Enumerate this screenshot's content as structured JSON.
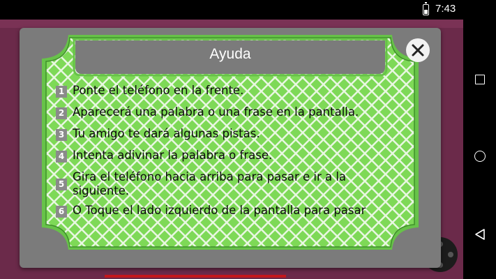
{
  "status_bar": {
    "time": "7:43",
    "battery_icon": "battery-charging-icon"
  },
  "nav_bar": {
    "recents_icon": "square-icon",
    "home_icon": "circle-icon",
    "back_icon": "triangle-back-icon"
  },
  "dialog": {
    "title": "Ayuda",
    "close_icon": "close-icon",
    "pattern_color": "#7ed957",
    "frame_color": "#67c249",
    "steps": [
      {
        "number": "1",
        "text": "Ponte el teléfono en la frente."
      },
      {
        "number": "2",
        "text": "Aparecerá una palabra o una frase en la pantalla."
      },
      {
        "number": "3",
        "text": "Tu amigo te dará algunas pistas."
      },
      {
        "number": "4",
        "text": "Intenta adivinar la palabra o frase."
      },
      {
        "number": "5",
        "text": "Gira el teléfono hacia arriba para pasar e ir a la siguiente."
      },
      {
        "number": "6",
        "text": "O Toque el lado izquierdo de la pantalla para pasar"
      }
    ]
  }
}
